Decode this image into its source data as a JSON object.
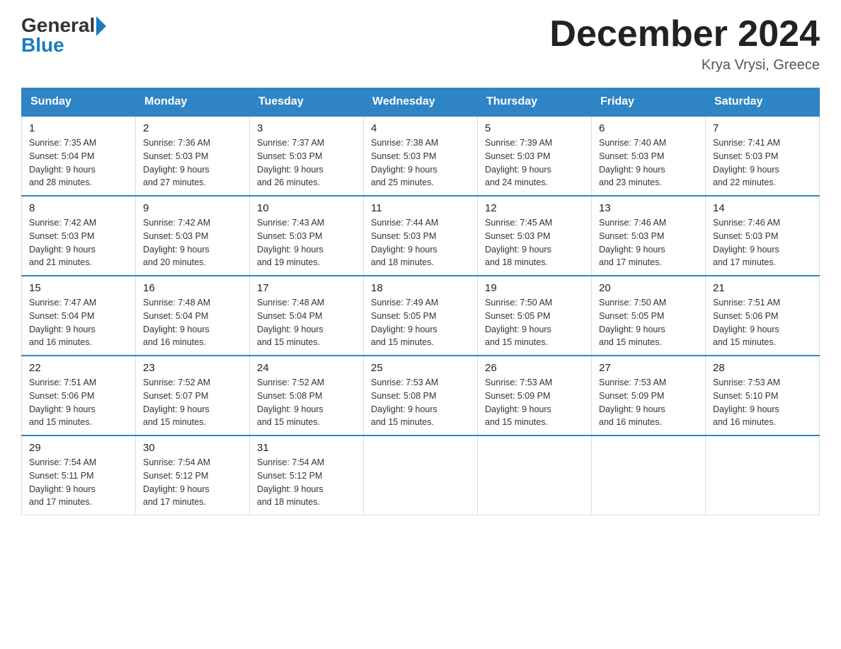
{
  "logo": {
    "general": "General",
    "blue": "Blue"
  },
  "header": {
    "month_title": "December 2024",
    "location": "Krya Vrysi, Greece"
  },
  "days_of_week": [
    "Sunday",
    "Monday",
    "Tuesday",
    "Wednesday",
    "Thursday",
    "Friday",
    "Saturday"
  ],
  "weeks": [
    [
      {
        "day": "1",
        "sunrise": "7:35 AM",
        "sunset": "5:04 PM",
        "daylight": "9 hours and 28 minutes."
      },
      {
        "day": "2",
        "sunrise": "7:36 AM",
        "sunset": "5:03 PM",
        "daylight": "9 hours and 27 minutes."
      },
      {
        "day": "3",
        "sunrise": "7:37 AM",
        "sunset": "5:03 PM",
        "daylight": "9 hours and 26 minutes."
      },
      {
        "day": "4",
        "sunrise": "7:38 AM",
        "sunset": "5:03 PM",
        "daylight": "9 hours and 25 minutes."
      },
      {
        "day": "5",
        "sunrise": "7:39 AM",
        "sunset": "5:03 PM",
        "daylight": "9 hours and 24 minutes."
      },
      {
        "day": "6",
        "sunrise": "7:40 AM",
        "sunset": "5:03 PM",
        "daylight": "9 hours and 23 minutes."
      },
      {
        "day": "7",
        "sunrise": "7:41 AM",
        "sunset": "5:03 PM",
        "daylight": "9 hours and 22 minutes."
      }
    ],
    [
      {
        "day": "8",
        "sunrise": "7:42 AM",
        "sunset": "5:03 PM",
        "daylight": "9 hours and 21 minutes."
      },
      {
        "day": "9",
        "sunrise": "7:42 AM",
        "sunset": "5:03 PM",
        "daylight": "9 hours and 20 minutes."
      },
      {
        "day": "10",
        "sunrise": "7:43 AM",
        "sunset": "5:03 PM",
        "daylight": "9 hours and 19 minutes."
      },
      {
        "day": "11",
        "sunrise": "7:44 AM",
        "sunset": "5:03 PM",
        "daylight": "9 hours and 18 minutes."
      },
      {
        "day": "12",
        "sunrise": "7:45 AM",
        "sunset": "5:03 PM",
        "daylight": "9 hours and 18 minutes."
      },
      {
        "day": "13",
        "sunrise": "7:46 AM",
        "sunset": "5:03 PM",
        "daylight": "9 hours and 17 minutes."
      },
      {
        "day": "14",
        "sunrise": "7:46 AM",
        "sunset": "5:03 PM",
        "daylight": "9 hours and 17 minutes."
      }
    ],
    [
      {
        "day": "15",
        "sunrise": "7:47 AM",
        "sunset": "5:04 PM",
        "daylight": "9 hours and 16 minutes."
      },
      {
        "day": "16",
        "sunrise": "7:48 AM",
        "sunset": "5:04 PM",
        "daylight": "9 hours and 16 minutes."
      },
      {
        "day": "17",
        "sunrise": "7:48 AM",
        "sunset": "5:04 PM",
        "daylight": "9 hours and 15 minutes."
      },
      {
        "day": "18",
        "sunrise": "7:49 AM",
        "sunset": "5:05 PM",
        "daylight": "9 hours and 15 minutes."
      },
      {
        "day": "19",
        "sunrise": "7:50 AM",
        "sunset": "5:05 PM",
        "daylight": "9 hours and 15 minutes."
      },
      {
        "day": "20",
        "sunrise": "7:50 AM",
        "sunset": "5:05 PM",
        "daylight": "9 hours and 15 minutes."
      },
      {
        "day": "21",
        "sunrise": "7:51 AM",
        "sunset": "5:06 PM",
        "daylight": "9 hours and 15 minutes."
      }
    ],
    [
      {
        "day": "22",
        "sunrise": "7:51 AM",
        "sunset": "5:06 PM",
        "daylight": "9 hours and 15 minutes."
      },
      {
        "day": "23",
        "sunrise": "7:52 AM",
        "sunset": "5:07 PM",
        "daylight": "9 hours and 15 minutes."
      },
      {
        "day": "24",
        "sunrise": "7:52 AM",
        "sunset": "5:08 PM",
        "daylight": "9 hours and 15 minutes."
      },
      {
        "day": "25",
        "sunrise": "7:53 AM",
        "sunset": "5:08 PM",
        "daylight": "9 hours and 15 minutes."
      },
      {
        "day": "26",
        "sunrise": "7:53 AM",
        "sunset": "5:09 PM",
        "daylight": "9 hours and 15 minutes."
      },
      {
        "day": "27",
        "sunrise": "7:53 AM",
        "sunset": "5:09 PM",
        "daylight": "9 hours and 16 minutes."
      },
      {
        "day": "28",
        "sunrise": "7:53 AM",
        "sunset": "5:10 PM",
        "daylight": "9 hours and 16 minutes."
      }
    ],
    [
      {
        "day": "29",
        "sunrise": "7:54 AM",
        "sunset": "5:11 PM",
        "daylight": "9 hours and 17 minutes."
      },
      {
        "day": "30",
        "sunrise": "7:54 AM",
        "sunset": "5:12 PM",
        "daylight": "9 hours and 17 minutes."
      },
      {
        "day": "31",
        "sunrise": "7:54 AM",
        "sunset": "5:12 PM",
        "daylight": "9 hours and 18 minutes."
      },
      null,
      null,
      null,
      null
    ]
  ],
  "labels": {
    "sunrise": "Sunrise:",
    "sunset": "Sunset:",
    "daylight": "Daylight:"
  }
}
